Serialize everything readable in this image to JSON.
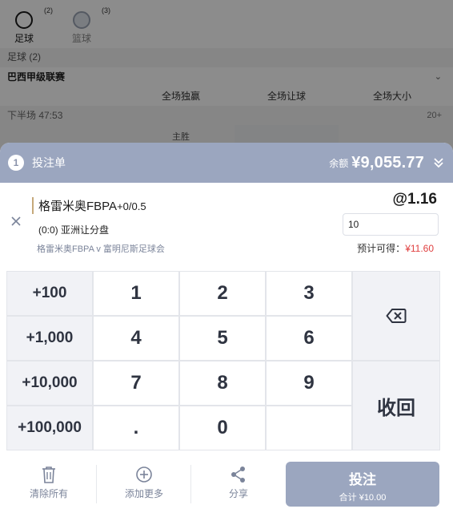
{
  "background": {
    "sports": [
      {
        "label": "足球",
        "count": "(2)"
      },
      {
        "label": "篮球",
        "count": "(3)"
      }
    ],
    "section_label": "足球 (2)",
    "league": "巴西甲级联赛",
    "columns": [
      "全场独赢",
      "全场让球",
      "全场大小"
    ],
    "match_time": "下半场 47:53",
    "more": "20+",
    "home_cell": "主胜"
  },
  "bet_slip": {
    "count": "1",
    "title": "投注单",
    "balance_label": "余额",
    "balance": "¥9,055.77",
    "selection": {
      "team": "格雷米奥FBPA",
      "handicap": "+0/0.5",
      "market": "(0:0) 亚洲让分盘",
      "match": "格雷米奥FBPA v 富明尼斯足球会",
      "odds": "@1.16",
      "stake": "10",
      "est_win_label": "预计可得：",
      "est_win": "¥11.60"
    },
    "keypad": {
      "quick": [
        "+100",
        "+1,000",
        "+10,000",
        "+100,000"
      ],
      "digits": [
        "1",
        "2",
        "3",
        "4",
        "5",
        "6",
        "7",
        "8",
        "9",
        ".",
        "0",
        ""
      ],
      "backspace_icon": "backspace-icon",
      "collapse": "收回"
    },
    "footer": {
      "clear": "清除所有",
      "add_more": "添加更多",
      "share": "分享",
      "place": "投注",
      "total": "合计 ¥10.00"
    }
  },
  "colors": {
    "header_bg": "#9ba6bf",
    "accent_red": "#e04040",
    "muted_text": "#7b849a"
  }
}
